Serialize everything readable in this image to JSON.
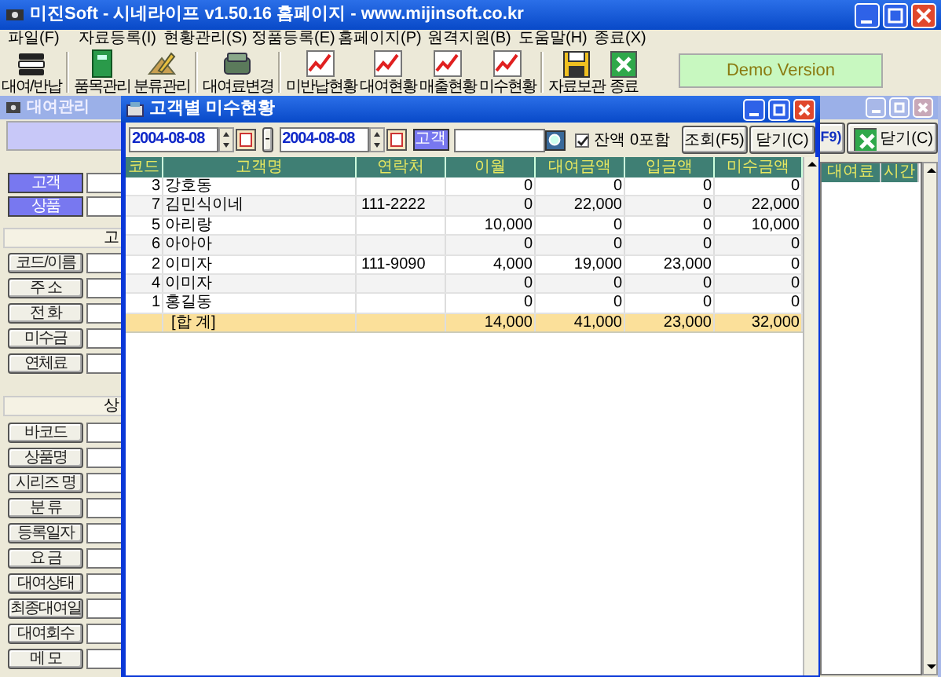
{
  "window": {
    "title": "미진Soft - 시네라이프 v1.50.16 홈페이지 - www.mijinsoft.co.kr"
  },
  "menu": [
    "파일(F)",
    "자료등록(I)",
    "현황관리(S)",
    "정품등록(E)",
    "홈페이지(P)",
    "원격지원(B)",
    "도움말(H)",
    "종료(X)"
  ],
  "toolbar": [
    [
      {
        "label": "대여/반납",
        "kind": "stack"
      }
    ],
    [
      {
        "label": "품목관리",
        "kind": "book"
      },
      {
        "label": "분류관리",
        "kind": "pencil"
      }
    ],
    [
      {
        "label": "대여료변경",
        "kind": "money"
      }
    ],
    [
      {
        "label": "미반납현황",
        "kind": "chart"
      },
      {
        "label": "대여현황",
        "kind": "chart"
      },
      {
        "label": "매출현황",
        "kind": "chart"
      },
      {
        "label": "미수현황",
        "kind": "chart"
      }
    ],
    [
      {
        "label": "자료보관",
        "kind": "floppy"
      },
      {
        "label": "종료",
        "kind": "exit"
      }
    ]
  ],
  "demo_badge": "Demo Version",
  "rental_window": {
    "title": "대여관리",
    "customer_button": "고객",
    "product_button": "상품",
    "customer_section": "고",
    "customer_fields": [
      "코드/이름",
      "주 소",
      "전 화",
      "미수금",
      "연체료"
    ],
    "product_section": "상",
    "product_fields": [
      "바코드",
      "상품명",
      "시리즈 명",
      "분 류",
      "등록일자",
      "요 금",
      "대여상태",
      "최종대여일",
      "대여회수",
      "메 모"
    ],
    "partial_button": "F9)",
    "close_button": "닫기(C)",
    "columns": [
      "대여료",
      "시간"
    ]
  },
  "dialog": {
    "title": "고객별 미수현황",
    "date_from": "2004-08-08",
    "separator": "-",
    "date_to": "2004-08-08",
    "customer_button": "고객",
    "include_zero": {
      "label": "잔액 0포함",
      "checked": true
    },
    "search_button": "조회(F5)",
    "close_button": "닫기(C)",
    "table": {
      "columns": [
        "코드",
        "고객명",
        "연락처",
        "이월",
        "대여금액",
        "입금액",
        "미수금액"
      ],
      "rows": [
        {
          "code": "3",
          "name": "강호동",
          "values": [
            "0",
            "0",
            "0",
            "0"
          ]
        },
        {
          "code": "7",
          "name": "김민식이네",
          "phone": "111-2222",
          "values": [
            "0",
            "22,000",
            "0",
            "22,000"
          ]
        },
        {
          "code": "5",
          "name": "아리랑",
          "values": [
            "10,000",
            "0",
            "0",
            "10,000"
          ]
        },
        {
          "code": "6",
          "name": "아아아",
          "values": [
            "0",
            "0",
            "0",
            "0"
          ]
        },
        {
          "code": "2",
          "name": "이미자",
          "phone": "111-9090",
          "values": [
            "4,000",
            "19,000",
            "23,000",
            "0"
          ]
        },
        {
          "code": "4",
          "name": "이미자",
          "values": [
            "0",
            "0",
            "0",
            "0"
          ]
        },
        {
          "code": "1",
          "name": "홍길동",
          "values": [
            "0",
            "0",
            "0",
            "0"
          ]
        }
      ],
      "total": {
        "label": "[합 계]",
        "values": [
          "14,000",
          "41,000",
          "23,000",
          "32,000"
        ]
      }
    }
  }
}
